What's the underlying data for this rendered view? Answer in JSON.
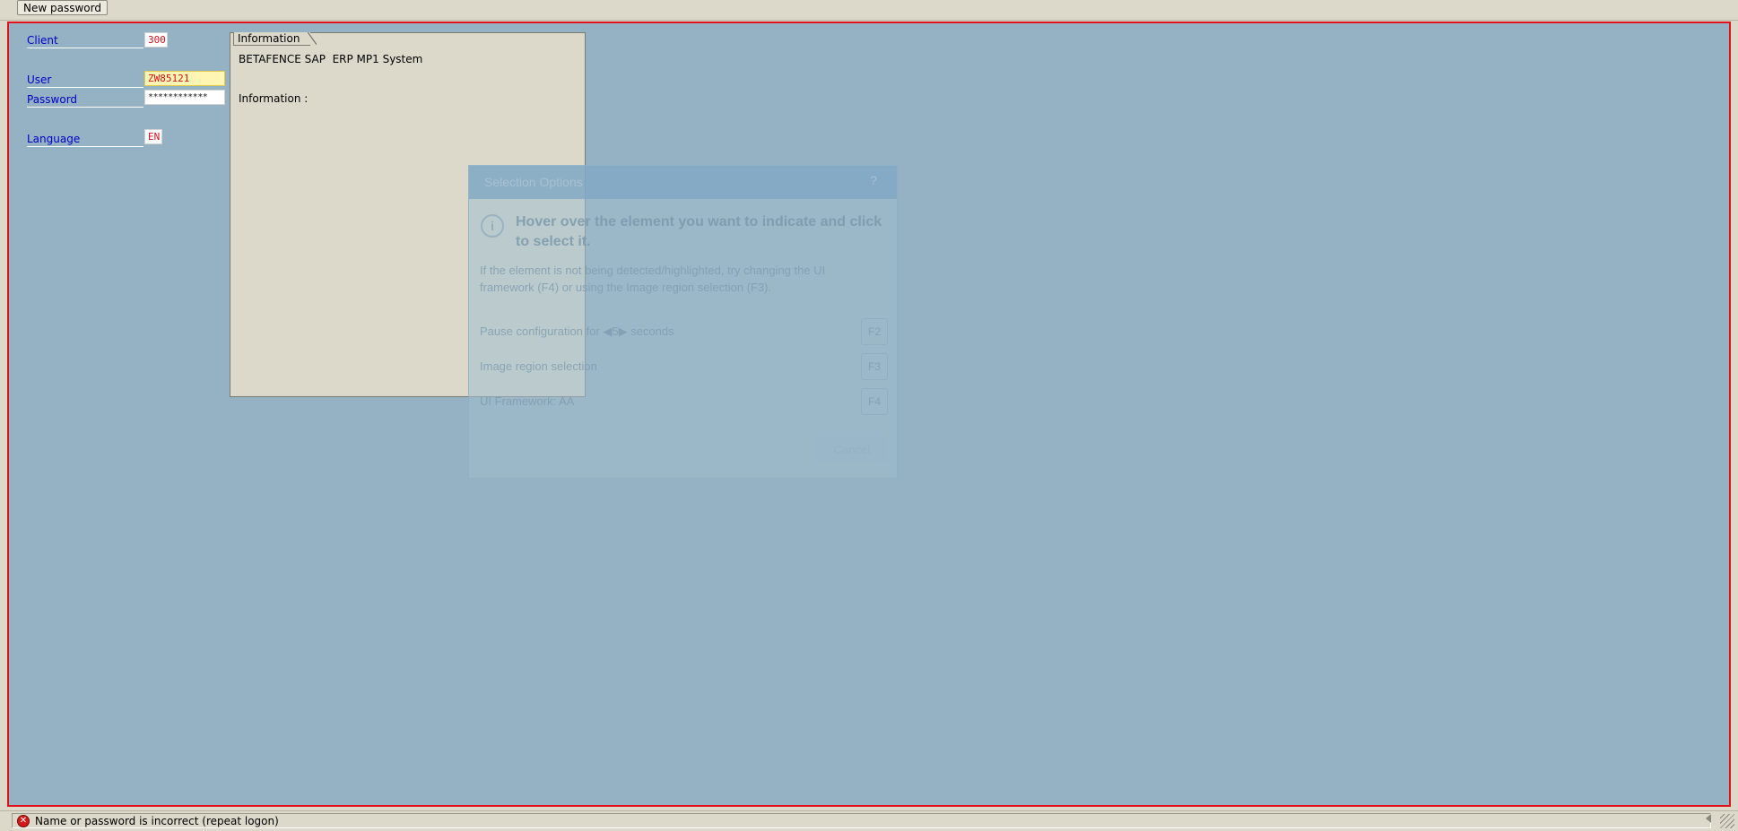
{
  "toolbar": {
    "new_password_label": "New password"
  },
  "login": {
    "client_label": "Client",
    "client_value": "300",
    "user_label": "User",
    "user_value": "ZW85121",
    "password_label": "Password",
    "password_value": "************",
    "language_label": "Language",
    "language_value": "EN"
  },
  "info_panel": {
    "tab_label": "Information",
    "system_line": "BETAFENCE SAP  ERP MP1 System",
    "info_line": "Information :"
  },
  "selection_overlay": {
    "title": "Selection Options",
    "help": "?",
    "info_icon": "i",
    "heading": "Hover over the element you want to indicate and click to select it.",
    "description": "If the element is not being detected/highlighted, try changing the UI framework (F4) or using the Image region selection (F3).",
    "pause_prefix": "Pause configuration for",
    "pause_value": "5",
    "pause_suffix": "seconds",
    "pause_key": "F2",
    "image_region_label": "Image region selection",
    "image_region_key": "F3",
    "framework_label": "UI Framework: AA",
    "framework_key": "F4",
    "cancel_label": "Cancel"
  },
  "status_bar": {
    "message": "Name or password is incorrect (repeat logon)",
    "icon": "error-icon"
  },
  "colors": {
    "highlight_border": "#e0121b",
    "screen_bg": "#95b1c4",
    "label_blue": "#0000c8",
    "value_red": "#d4101d"
  }
}
